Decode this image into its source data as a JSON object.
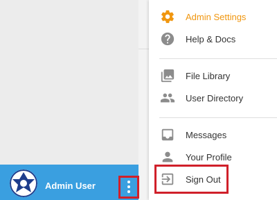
{
  "colors": {
    "accent": "#f0960f",
    "icon_grey": "#8c8c8c",
    "sidebar_blue": "#3a9fe0",
    "highlight_red": "#d0202a"
  },
  "sidebar": {
    "user_name": "Admin User",
    "avatar_icon": "user-avatar-icon",
    "more_icon": "more-vertical-icon"
  },
  "menu": {
    "items": [
      {
        "label": "Admin Settings",
        "icon": "gear-icon",
        "active": true
      },
      {
        "label": "Help & Docs",
        "icon": "help-icon",
        "active": false
      },
      {
        "label": "File Library",
        "icon": "image-library-icon",
        "active": false
      },
      {
        "label": "User Directory",
        "icon": "people-icon",
        "active": false
      },
      {
        "label": "Messages",
        "icon": "inbox-icon",
        "active": false
      },
      {
        "label": "Your Profile",
        "icon": "person-icon",
        "active": false
      },
      {
        "label": "Sign Out",
        "icon": "sign-out-icon",
        "active": false
      }
    ]
  }
}
